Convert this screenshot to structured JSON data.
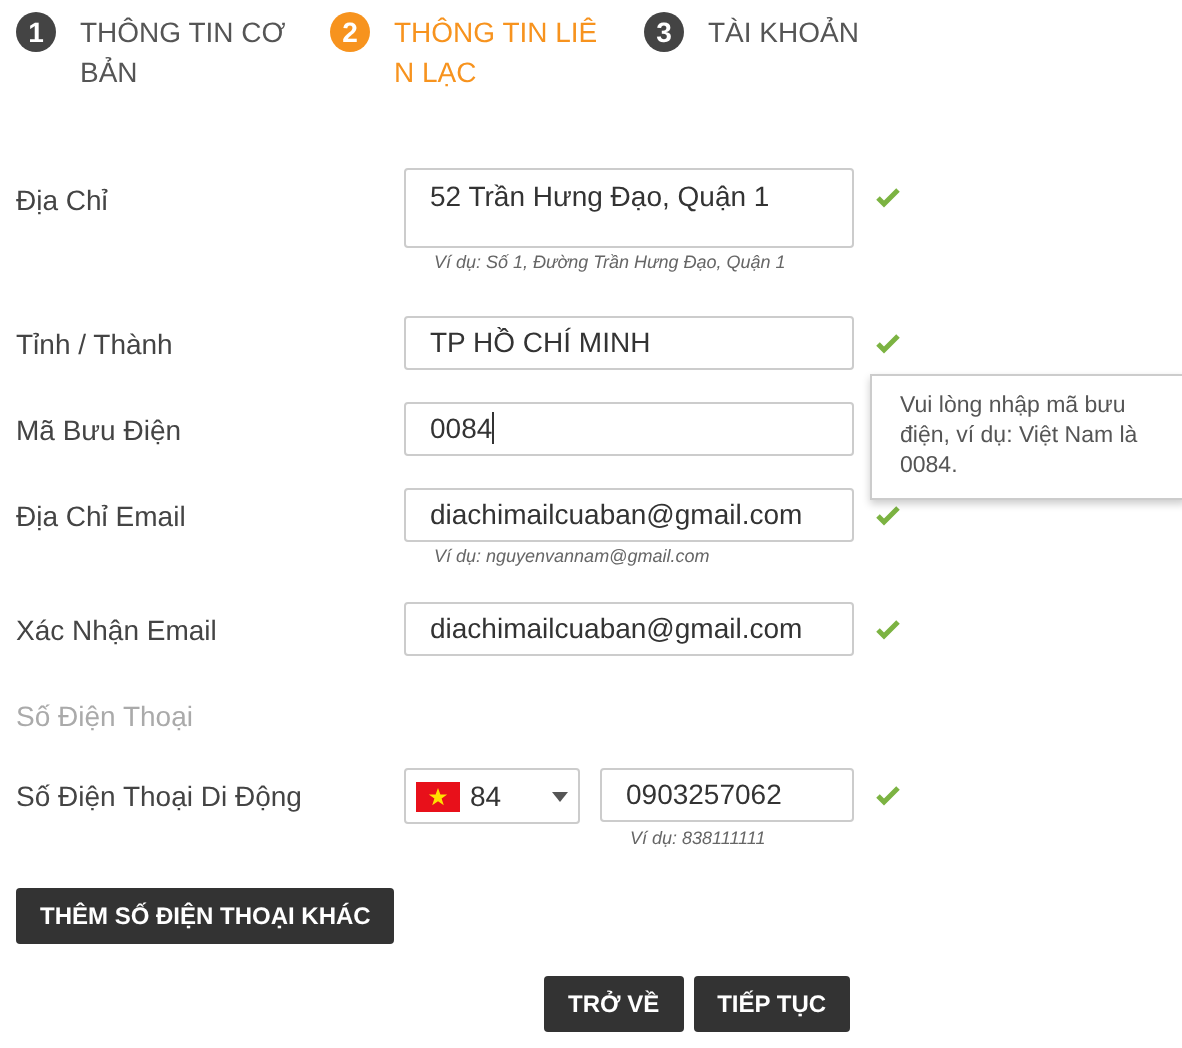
{
  "steps": [
    {
      "number": "1",
      "lines": [
        "THÔNG TIN CƠ",
        "BẢN"
      ],
      "selected": false
    },
    {
      "number": "2",
      "lines": [
        "THÔNG TIN LIÊ",
        "N LẠC"
      ],
      "selected": true
    },
    {
      "number": "3",
      "lines": [
        "TÀI KHOẢN"
      ],
      "selected": false
    }
  ],
  "fields": [
    {
      "kind": "textarea",
      "label": "Địa Chỉ",
      "value": "52 Trần Hưng Đạo, Quận 1",
      "hint": "Ví dụ: Số 1, Đường Trần Hưng Đạo, Quận 1",
      "valid": true
    },
    {
      "kind": "text",
      "label": "Tỉnh / Thành",
      "value": "TP HỒ CHÍ MINH",
      "valid": true
    },
    {
      "kind": "text",
      "label": "Mã Bưu Điện",
      "value": "0084",
      "valid": false,
      "focused": true,
      "tooltip": "Vui lòng nhập mã bưu điện, ví dụ: Việt Nam là 0084."
    },
    {
      "kind": "text",
      "label": "Địa Chỉ Email",
      "value": "diachimailcuaban@gmail.com",
      "hint": "Ví dụ: nguyenvannam@gmail.com",
      "valid": true
    },
    {
      "kind": "text",
      "label": "Xác Nhận Email",
      "value": "diachimailcuaban@gmail.com",
      "valid": true
    },
    {
      "kind": "section",
      "label": "Số Điện Thoại"
    },
    {
      "kind": "phone",
      "label": "Số Điện Thoại Di Động",
      "code": "84",
      "value": "0903257062",
      "hint": "Ví dụ: 838111111",
      "valid": true
    }
  ],
  "add_button": "THÊM SỐ ĐIỆN THOẠI KHÁC",
  "buttons": [
    "TRỞ VỀ",
    "TIẾP TỤC"
  ]
}
